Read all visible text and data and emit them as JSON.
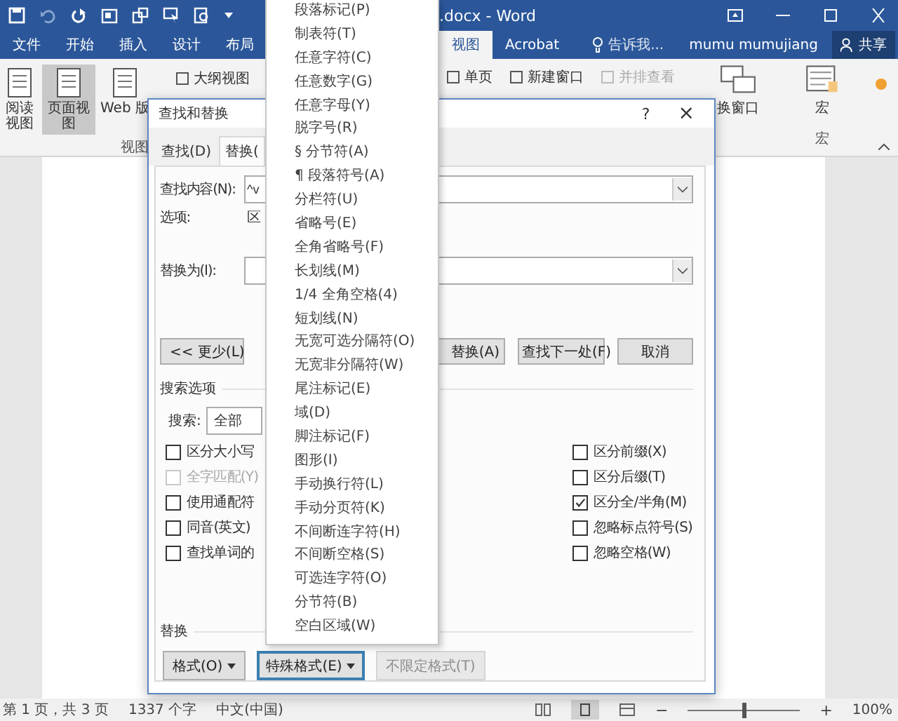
{
  "window": {
    "title": ".docx - Word"
  },
  "tabs_left": [
    {
      "label": "文件",
      "selected": false
    },
    {
      "label": "开始",
      "selected": false
    },
    {
      "label": "插入",
      "selected": false
    },
    {
      "label": "设计",
      "selected": false
    },
    {
      "label": "布局",
      "selected": false
    }
  ],
  "tabs_right": [
    {
      "label": "视图",
      "selected": true
    },
    {
      "label": "Acrobat",
      "selected": false
    }
  ],
  "tell_me": "告诉我...",
  "user": "mumu mumujiang",
  "share": "共享",
  "ribbon": {
    "view_buttons": [
      {
        "label": "阅读视图",
        "selected": false
      },
      {
        "label": "页面视图",
        "selected": true
      },
      {
        "label": "Web 版",
        "selected": false
      }
    ],
    "outline": "大纲视图",
    "view_group": "视图",
    "window_items": [
      {
        "label": "单页",
        "disabled": false
      },
      {
        "label": "新建窗口",
        "disabled": false
      },
      {
        "label": "并排查看",
        "disabled": true
      }
    ],
    "switch_windows": "换窗口",
    "macros": "宏",
    "macros_group": "宏"
  },
  "dialog": {
    "title": "查找和替换",
    "help": "?",
    "close": "×",
    "tabs": [
      {
        "label": "查找(D)",
        "selected": false
      },
      {
        "label": "替换(",
        "selected": true
      }
    ],
    "find_label": "查找内容(N):",
    "find_value": "^v",
    "options_label": "选项:",
    "options_value": "区",
    "replace_label": "替换为(I):",
    "less": "<< 更少(L)",
    "replace_all": "替换(A)",
    "find_next": "查找下一处(F)",
    "cancel": "取消",
    "search_options": "搜索选项",
    "search_label": "搜索:",
    "search_value": "全部",
    "checks_left": [
      {
        "label": "区分大小写",
        "checked": false,
        "disabled": false
      },
      {
        "label": "全字匹配(Y)",
        "checked": false,
        "disabled": true
      },
      {
        "label": "使用通配符",
        "checked": false,
        "disabled": false
      },
      {
        "label": "同音(英文)",
        "checked": false,
        "disabled": false
      },
      {
        "label": "查找单词的",
        "checked": false,
        "disabled": false
      }
    ],
    "checks_right": [
      {
        "label": "区分前缀(X)",
        "checked": false,
        "disabled": false
      },
      {
        "label": "区分后缀(T)",
        "checked": false,
        "disabled": false
      },
      {
        "label": "区分全/半角(M)",
        "checked": true,
        "disabled": false
      },
      {
        "label": "忽略标点符号(S)",
        "checked": false,
        "disabled": false
      },
      {
        "label": "忽略空格(W)",
        "checked": false,
        "disabled": false
      }
    ],
    "replace_section": "替换",
    "bottom_buttons": [
      {
        "label": "格式(O)",
        "kind": "dropdown",
        "disabled": false,
        "focused": false
      },
      {
        "label": "特殊格式(E)",
        "kind": "dropdown",
        "disabled": false,
        "focused": true
      },
      {
        "label": "不限定格式(T)",
        "kind": "plain",
        "disabled": true,
        "focused": false
      }
    ]
  },
  "menu": [
    "段落标记(P)",
    "制表符(T)",
    "任意字符(C)",
    "任意数字(G)",
    "任意字母(Y)",
    "脱字号(R)",
    "§ 分节符(A)",
    "¶ 段落符号(A)",
    "分栏符(U)",
    "省略号(E)",
    "全角省略号(F)",
    "长划线(M)",
    "1/4 全角空格(4)",
    "短划线(N)",
    "无宽可选分隔符(O)",
    "无宽非分隔符(W)",
    "尾注标记(E)",
    "域(D)",
    "脚注标记(F)",
    "图形(I)",
    "手动换行符(L)",
    "手动分页符(K)",
    "不间断连字符(H)",
    "不间断空格(S)",
    "可选连字符(O)",
    "分节符(B)",
    "空白区域(W)"
  ],
  "status_bar": {
    "page": "第 1 页，共 3 页",
    "words": "1337 个字",
    "language": "中文(中国)",
    "zoom_out": "−",
    "zoom": {
      "level": 0.5
    },
    "zoom_in": "+",
    "zoom_text": "100%"
  }
}
